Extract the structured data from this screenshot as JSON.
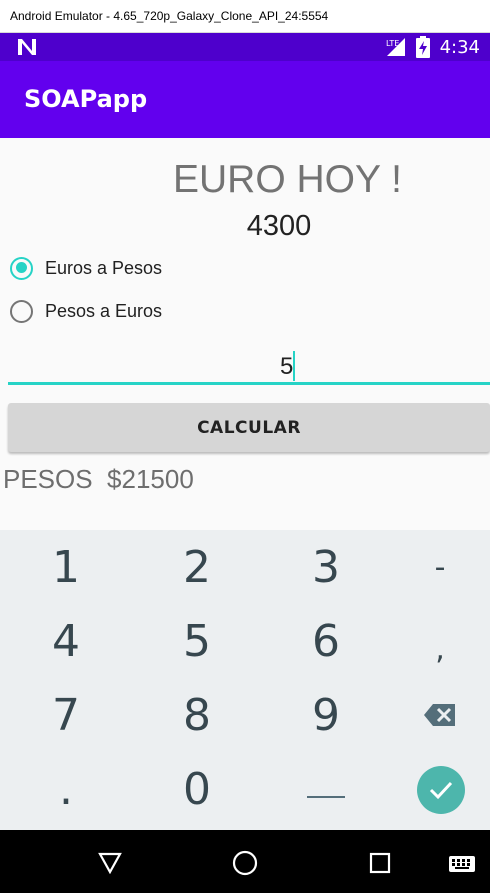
{
  "window": {
    "title": "Android Emulator - 4.65_720p_Galaxy_Clone_API_24:5554"
  },
  "status_bar": {
    "time": "4:34",
    "icons": [
      "n-notification-icon",
      "wifi-icon",
      "battery-charging-icon"
    ]
  },
  "app_bar": {
    "title": "SOAPapp"
  },
  "content": {
    "heading": "EURO HOY !",
    "rate": "4300",
    "radio_options": [
      {
        "label": "Euros a Pesos",
        "selected": true
      },
      {
        "label": "Pesos a Euros",
        "selected": false
      }
    ],
    "amount_input": {
      "value": "5"
    },
    "calculate_button": "CALCULAR",
    "result": "PESOS  $21500"
  },
  "keyboard": {
    "rows": [
      [
        "1",
        "2",
        "3",
        "-"
      ],
      [
        "4",
        "5",
        "6",
        ","
      ],
      [
        "7",
        "8",
        "9",
        "backspace"
      ],
      [
        ".",
        "0",
        "␣",
        "done"
      ]
    ],
    "space_glyph": "___",
    "accent_color": "#4db6ac"
  },
  "colors": {
    "primary": "#6200ee",
    "primary_dark": "#4e00cc",
    "accent": "#26d3c6"
  },
  "nav_bar": {
    "icons": [
      "back-icon",
      "home-icon",
      "recents-icon",
      "keyboard-switch-icon"
    ]
  }
}
